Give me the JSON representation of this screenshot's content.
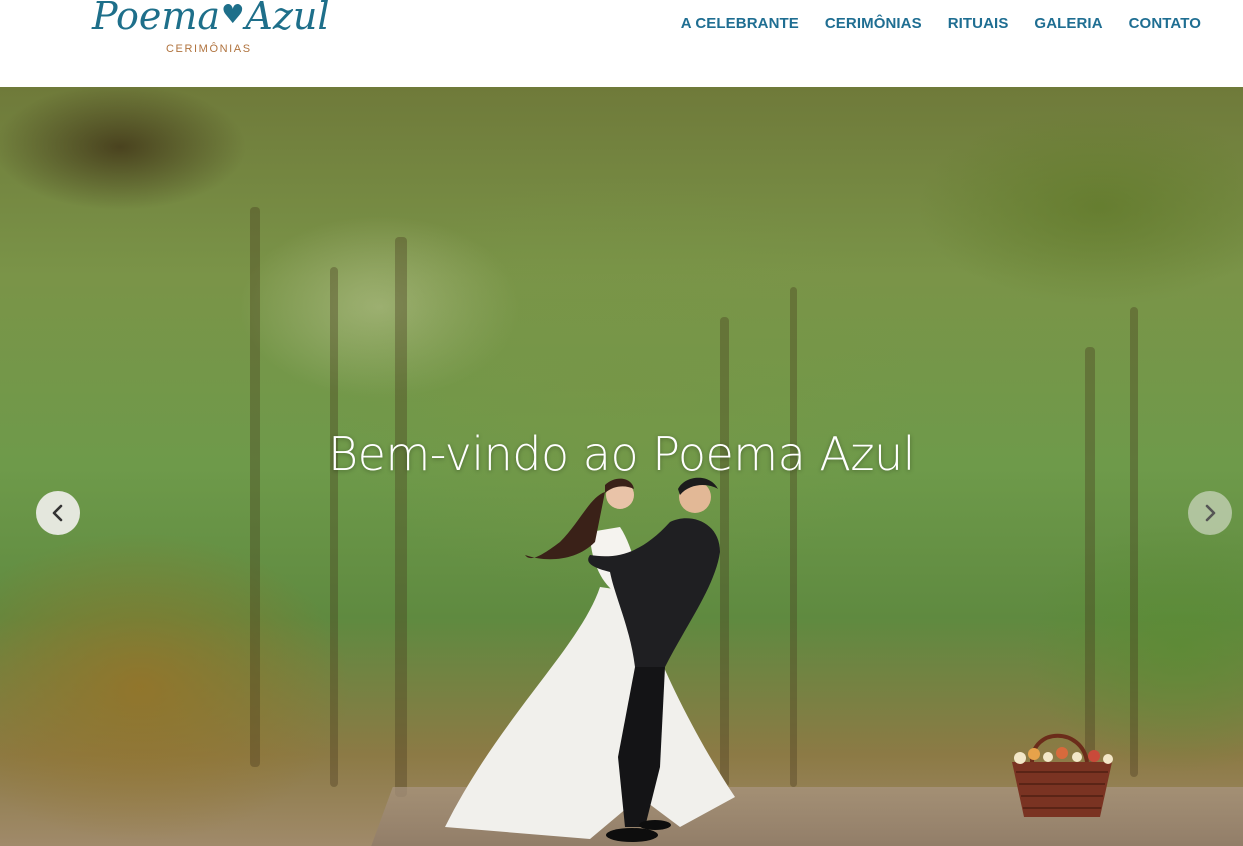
{
  "brand": {
    "script_left": "Poema",
    "script_right": "Azul",
    "subtitle": "CERIMÔNIAS",
    "color_primary": "#1e6f8a",
    "color_accent": "#b0733e"
  },
  "nav": {
    "items": [
      {
        "label": "A CELEBRANTE"
      },
      {
        "label": "CERIMÔNIAS"
      },
      {
        "label": "RITUAIS"
      },
      {
        "label": "GALERIA"
      },
      {
        "label": "CONTATO"
      }
    ],
    "color": "#1f6e92"
  },
  "hero": {
    "title": "Bem-vindo ao Poema Azul",
    "prev_icon": "chevron-left-icon",
    "next_icon": "chevron-right-icon",
    "image_subject": "couple embracing in forest path"
  }
}
